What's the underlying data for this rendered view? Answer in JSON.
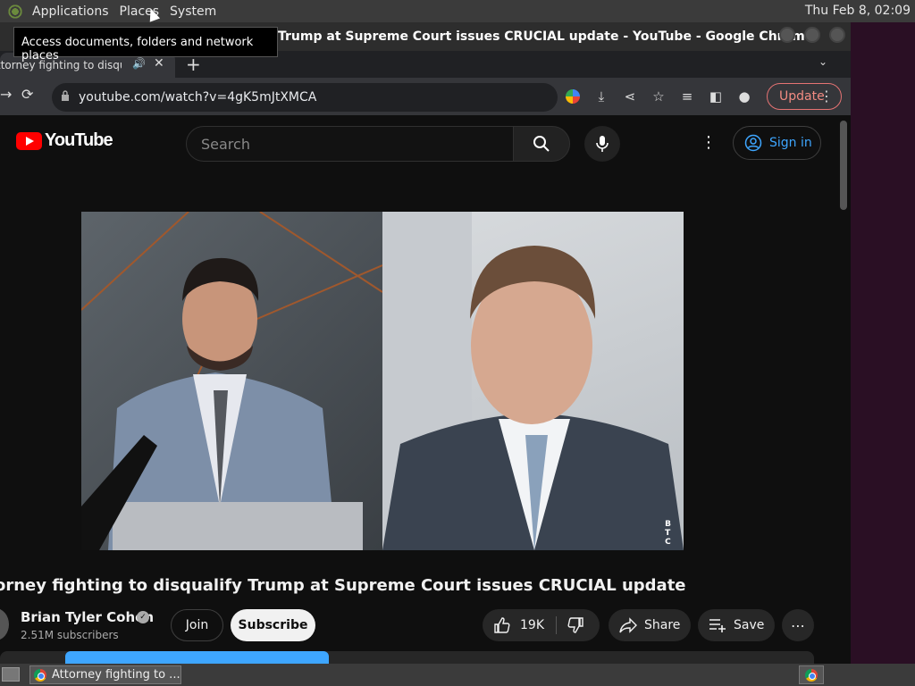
{
  "topbar": {
    "menu": [
      "Applications",
      "Places",
      "System"
    ],
    "clock": "Thu Feb  8, 02:09"
  },
  "tooltip": "Access documents, folders and network places",
  "window": {
    "title": "Trump at Supreme Court issues CRUCIAL update - YouTube - Google Chrome"
  },
  "tab": {
    "label": "ttorney fighting to disqu",
    "close": "✕",
    "new_tab": "+"
  },
  "toolbar": {
    "url": "youtube.com/watch?v=4gK5mJtXMCA",
    "update_label": "Update"
  },
  "youtube": {
    "logo_text": "YouTube",
    "search_placeholder": "Search",
    "signin_label": "Sign in"
  },
  "video": {
    "title": "orney fighting to disqualify Trump at Supreme Court issues CRUCIAL update",
    "watermark": [
      "B",
      "T",
      "C"
    ]
  },
  "channel": {
    "name": "Brian Tyler Cohen",
    "subscribers": "2.51M subscribers",
    "join_label": "Join",
    "subscribe_label": "Subscribe"
  },
  "actions": {
    "likes": "19K",
    "share_label": "Share",
    "save_label": "Save"
  },
  "taskbar": {
    "task_label": "Attorney fighting to ..."
  },
  "colors": {
    "youtube_red": "#ff0000",
    "link_blue": "#3ea6ff",
    "update_red": "#f28b82"
  }
}
